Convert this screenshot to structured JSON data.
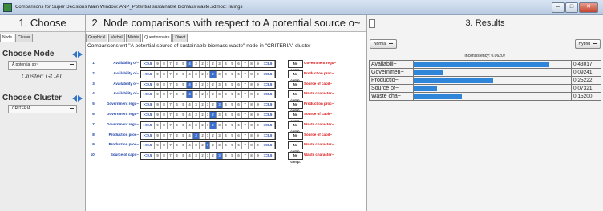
{
  "window": {
    "title": "Comparisons for Super Decisions Main Window: ANP_Potential sustainable biomass waste.sdmod: ratings",
    "min": "–",
    "max": "□",
    "close": "✕"
  },
  "choose": {
    "title": "1. Choose",
    "tabs": [
      "Node",
      "Cluster"
    ],
    "node_label": "Choose Node",
    "node_value": "A potential so~",
    "cluster_goal": "Cluster: GOAL",
    "cluster_label": "Choose Cluster",
    "cluster_value": "CRITERIA"
  },
  "compare": {
    "title": "2. Node comparisons with respect to A potential source o~",
    "tabs": [
      "Graphical",
      "Verbal",
      "Matrix",
      "Questionnaire",
      "Direct"
    ],
    "heading": "Comparisons wrt \"A potential source of sustainable biomass waste\" node in \"CRITERIA\" cluster",
    "scale": [
      ">=9.5",
      "9",
      "8",
      "7",
      "6",
      "5",
      "4",
      "3",
      "2",
      "1",
      "2",
      "3",
      "4",
      "5",
      "6",
      "7",
      "8",
      "9",
      ">=9.5"
    ],
    "no_comp": "No comp.",
    "rows": [
      {
        "n": "1.",
        "left": "Availability of~",
        "right": "Government regu~",
        "sel": 6
      },
      {
        "n": "2.",
        "left": "Availability of~",
        "right": "Production proc~",
        "sel": 10
      },
      {
        "n": "3.",
        "left": "Availability of~",
        "right": "Source of capit~",
        "sel": 6
      },
      {
        "n": "4.",
        "left": "Availability of~",
        "right": "Waste character~",
        "sel": 6
      },
      {
        "n": "5.",
        "left": "Government regu~",
        "right": "Production proc~",
        "sel": 11
      },
      {
        "n": "6.",
        "left": "Government regu~",
        "right": "Source of capit~",
        "sel": 10
      },
      {
        "n": "7.",
        "left": "Government regu~",
        "right": "Waste character~",
        "sel": 10
      },
      {
        "n": "8.",
        "left": "Production proc~",
        "right": "Source of capit~",
        "sel": 7
      },
      {
        "n": "9.",
        "left": "Production proc~",
        "right": "Waste character~",
        "sel": 9
      },
      {
        "n": "10.",
        "left": "Source of capit~",
        "right": "Waste character~",
        "sel": 11
      }
    ]
  },
  "results": {
    "title": "3. Results",
    "left_mode": "Normal",
    "right_mode": "Hybrid",
    "inconsistency": "Inconsistency: 0.06207",
    "accent": "#2f86d9",
    "items": [
      {
        "name": "Availabili~",
        "value": "0.43017",
        "v": 0.43017
      },
      {
        "name": "Governmen~",
        "value": "0.09241",
        "v": 0.09241
      },
      {
        "name": "Productio~",
        "value": "0.25222",
        "v": 0.25222
      },
      {
        "name": "Source of~",
        "value": "0.07321",
        "v": 0.07321
      },
      {
        "name": "Waste cha~",
        "value": "0.15200",
        "v": 0.152
      }
    ]
  }
}
